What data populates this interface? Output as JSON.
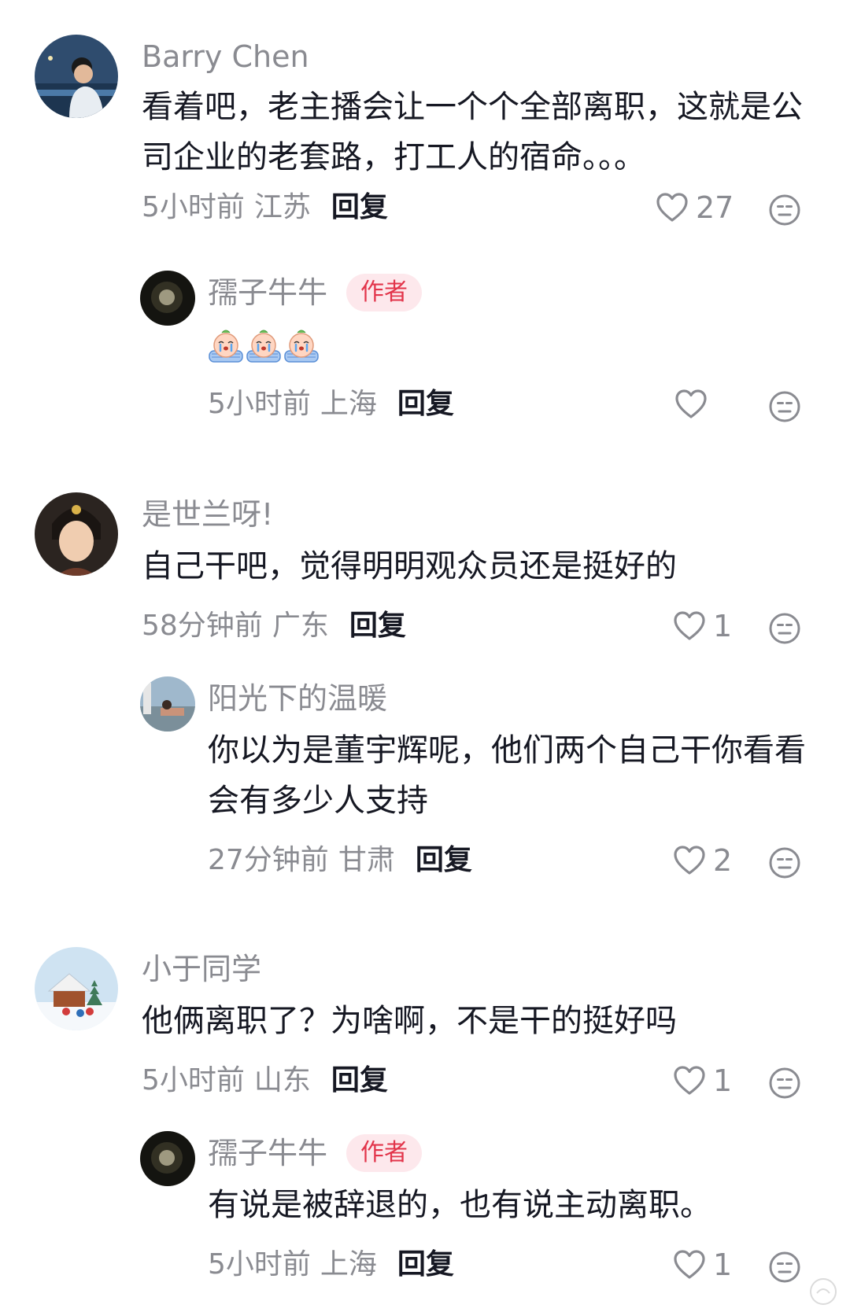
{
  "colors": {
    "name": "#8a8b91",
    "text": "#161823",
    "badge_bg": "#fde8ec",
    "badge_text": "#e2344a",
    "icon": "#8a8b91"
  },
  "icons": {
    "like": "heart-outline-icon",
    "dislike": "unhappy-face-icon"
  },
  "comments": [
    {
      "user": "Barry Chen",
      "text": "看着吧，老主播会让一个个全部离职，这就是公司企业的老套路，打工人的宿命。。。",
      "time": "5小时前",
      "location": "江苏",
      "reply_label": "回复",
      "likes": "27",
      "replies": [
        {
          "user": "孺子牛牛",
          "badge": "作者",
          "sticker_count": 3,
          "time": "5小时前",
          "location": "上海",
          "reply_label": "回复",
          "likes": ""
        }
      ]
    },
    {
      "user": "是世兰呀!",
      "text": "自己干吧，觉得明明观众员还是挺好的",
      "time": "58分钟前",
      "location": "广东",
      "reply_label": "回复",
      "likes": "1",
      "replies": [
        {
          "user": "阳光下的温暖",
          "text": "你以为是董宇辉呢，他们两个自己干你看看会有多少人支持",
          "time": "27分钟前",
          "location": "甘肃",
          "reply_label": "回复",
          "likes": "2"
        }
      ]
    },
    {
      "user": "小于同学",
      "text": "他俩离职了？为啥啊，不是干的挺好吗",
      "time": "5小时前",
      "location": "山东",
      "reply_label": "回复",
      "likes": "1",
      "replies": [
        {
          "user": "孺子牛牛",
          "badge": "作者",
          "text": "有说是被辞退的，也有说主动离职。",
          "time": "5小时前",
          "location": "上海",
          "reply_label": "回复",
          "likes": "1"
        }
      ]
    }
  ]
}
